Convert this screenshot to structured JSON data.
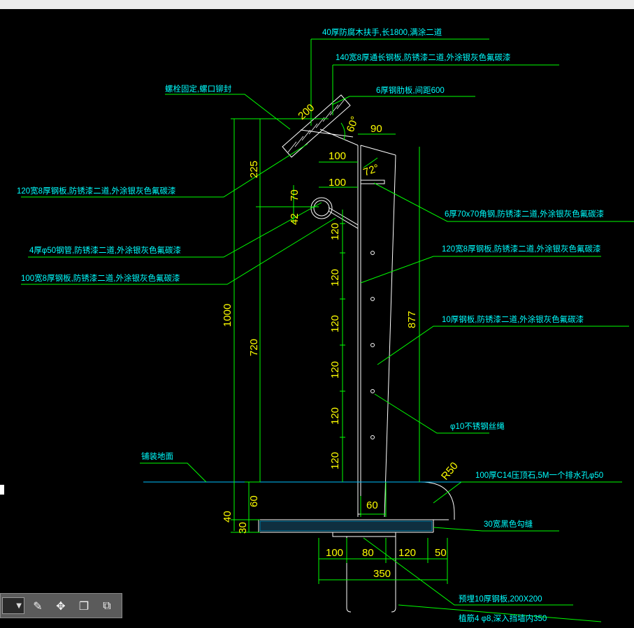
{
  "colors": {
    "bg": "#000000",
    "leader": "#00ff00",
    "note": "#00ffff",
    "dim": "#ffff00",
    "object": "#ffffff",
    "ground": "#00bfff",
    "hatch": "#00bfff"
  },
  "notes": {
    "handrail": "40厚防腐木扶手,长1800,满涂二道",
    "top_plate": "140宽8厚通长钢板,防锈漆二道,外涂银灰色氟碳漆",
    "bolt": "螺栓固定,螺口铆封",
    "rib": "6厚钢肋板,间距600",
    "plate_120": "120宽8厚钢板,防锈漆二道,外涂银灰色氟碳漆",
    "angle": "6厚70x70角钢,防锈漆二道,外涂银灰色氟碳漆",
    "pipe": "4厚φ50钢管,防锈漆二道,外涂银灰色氟碳漆",
    "plate_100": "100宽8厚钢板,防锈漆二道,外涂银灰色氟碳漆",
    "plate_120b": "120宽8厚钢板,防锈漆二道,外涂银灰色氟碳漆",
    "plate_10": "10厚钢板,防锈漆二道,外涂银灰色氟碳漆",
    "wire": "φ10不锈钢丝绳",
    "ground": "铺装地面",
    "curb": "100厚C14压顶石,5M一个排水孔φ50",
    "mortar": "30宽黑色勾缝",
    "embed": "预埋10厚钢板,200X200",
    "anchor": "植筋4 φ8,深入挡墙内350"
  },
  "dims": {
    "d200": "200",
    "d60deg": "60°",
    "d90": "90",
    "d100a": "100",
    "d72": "72°",
    "d100b": "100",
    "d225": "225",
    "d70": "70",
    "d42": "42",
    "d1000": "1000",
    "d720": "720",
    "d877": "877",
    "d120": "120",
    "r50": "R50",
    "d60": "60",
    "d40": "40",
    "d30": "30",
    "d60b": "60",
    "b100": "100",
    "b80": "80",
    "b120": "120",
    "b50": "50",
    "b350": "350"
  },
  "toolbar": {
    "combo_arrow": "▼",
    "edit_icon": "✎",
    "move_icon": "✥",
    "copy_icon": "❐",
    "paste_icon": "⧉"
  }
}
